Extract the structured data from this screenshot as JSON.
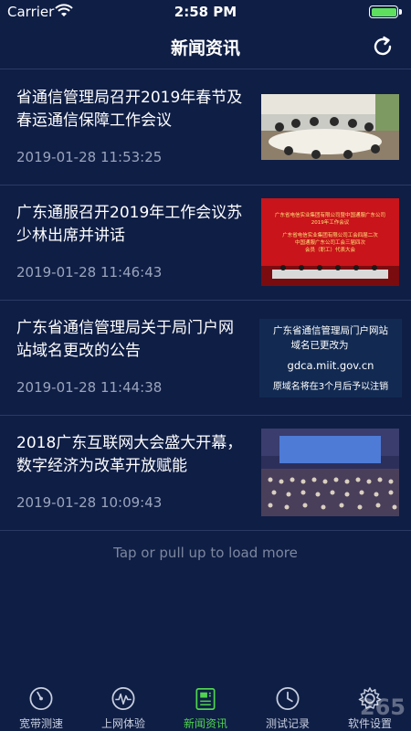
{
  "status": {
    "carrier": "Carrier",
    "time": "2:58 PM"
  },
  "header": {
    "title": "新闻资讯"
  },
  "news": [
    {
      "title": "省通信管理局召开2019年春节及春运通信保障工作会议",
      "time": "2019-01-28 11:53:25"
    },
    {
      "title": "广东通服召开2019年工作会议苏少林出席并讲话",
      "time": "2019-01-28 11:46:43",
      "image_text": [
        "广东省电信实业集团有限公司暨中国通服广东公司",
        "2019年工作会议",
        "广东省电信实业集团有限公司工会四届二次",
        "中国通服广东公司工会三届四次",
        "会员（职工）代表大会"
      ]
    },
    {
      "title": "广东省通信管理局关于局门户网站域名更改的公告",
      "time": "2019-01-28 11:44:38",
      "image_text": [
        "广东省通信管理局门户网站",
        "域名已更改为",
        "gdca.miit.gov.cn",
        "原域名将在3个月后予以注销"
      ]
    },
    {
      "title": "2018广东互联网大会盛大开幕，数字经济为改革开放赋能",
      "time": "2019-01-28 10:09:43"
    }
  ],
  "load_more": "Tap or pull up to load more",
  "tabs": [
    {
      "label": "宽带测速",
      "icon": "speedometer-icon"
    },
    {
      "label": "上网体验",
      "icon": "pulse-icon"
    },
    {
      "label": "新闻资讯",
      "icon": "news-icon",
      "active": true
    },
    {
      "label": "测试记录",
      "icon": "clock-icon"
    },
    {
      "label": "软件设置",
      "icon": "gear-icon"
    }
  ],
  "watermark": "265",
  "colors": {
    "background": "#0f1e45",
    "accent_green": "#4fd34f",
    "timestamp": "#9aa4bd"
  }
}
